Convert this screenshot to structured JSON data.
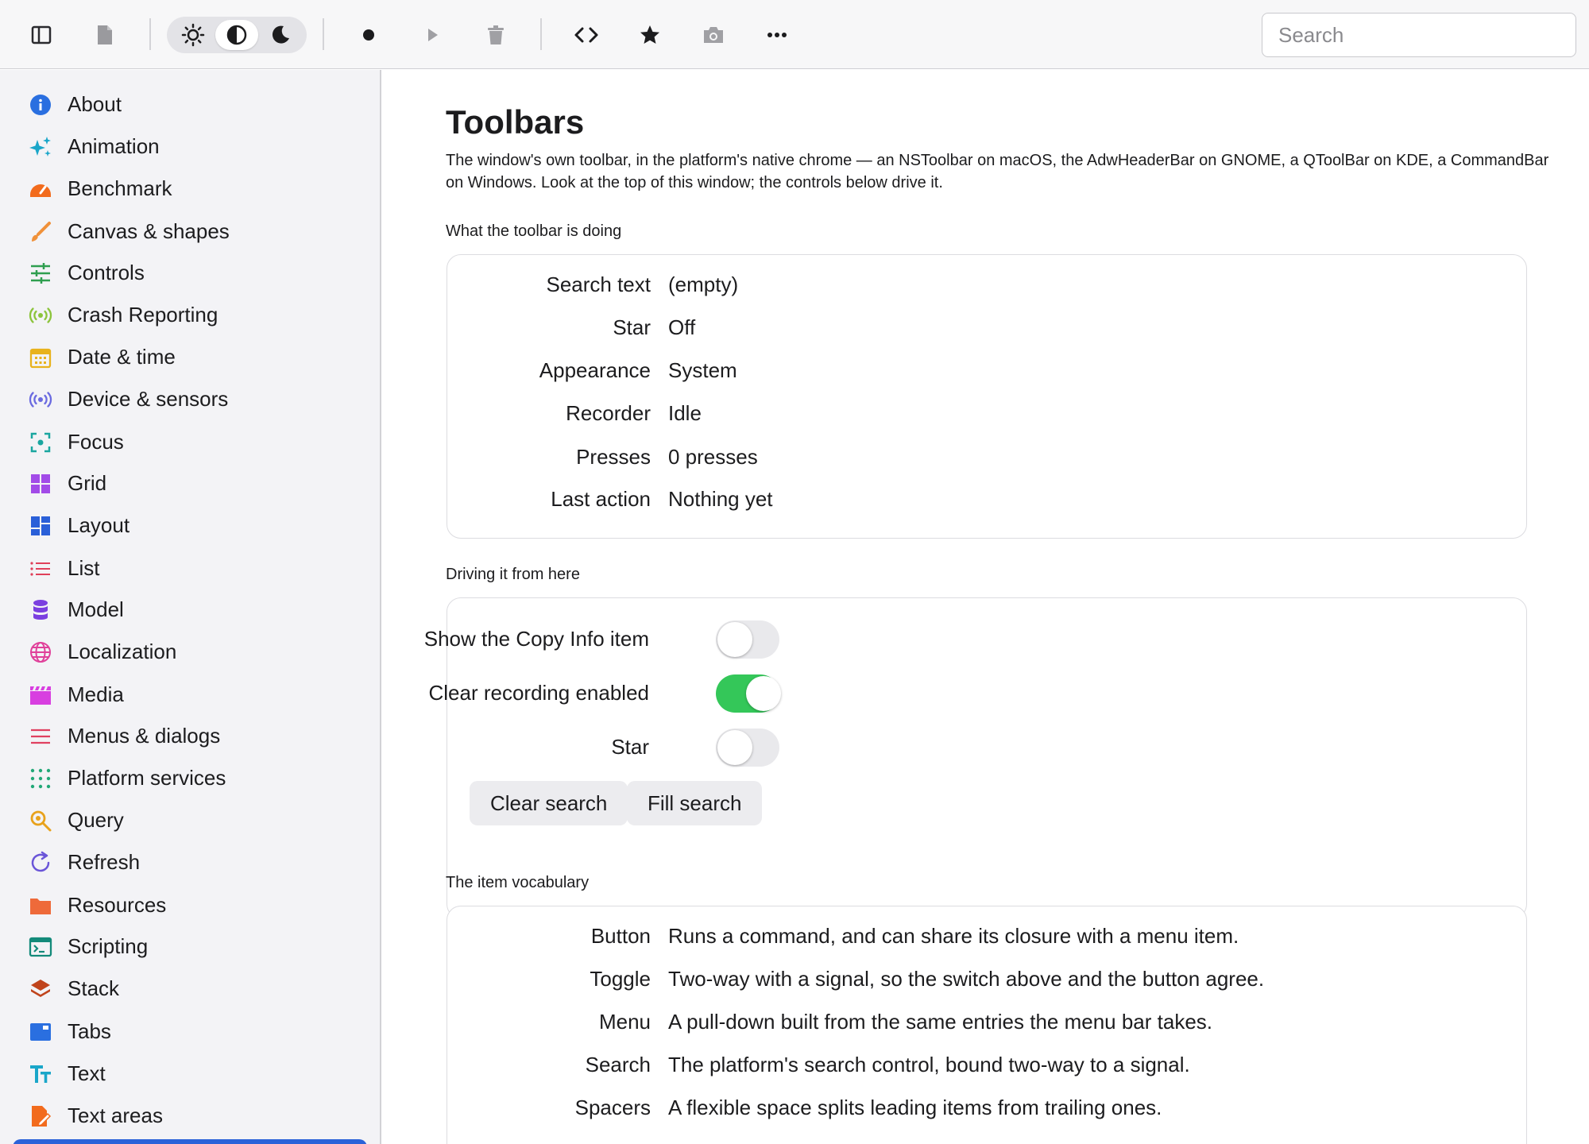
{
  "toolbar": {
    "search_placeholder": "Search",
    "search_value": "",
    "icons": [
      "sidebar-toggle-icon",
      "document-icon",
      "sun-icon",
      "contrast-icon",
      "moon-icon",
      "record-icon",
      "play-icon",
      "trash-icon",
      "code-icon",
      "star-icon",
      "camera-icon",
      "more-icon"
    ],
    "appearance_selected": "System"
  },
  "sidebar": {
    "items": [
      {
        "label": "About",
        "icon": "info-icon",
        "color": "#2a6fe0"
      },
      {
        "label": "Animation",
        "icon": "sparkles-icon",
        "color": "#1aa6c9"
      },
      {
        "label": "Benchmark",
        "icon": "gauge-icon",
        "color": "#f26b1d"
      },
      {
        "label": "Canvas & shapes",
        "icon": "brush-icon",
        "color": "#f0913a"
      },
      {
        "label": "Controls",
        "icon": "sliders-icon",
        "color": "#2e9e4f"
      },
      {
        "label": "Crash Reporting",
        "icon": "broadcast-icon",
        "color": "#8cc43c"
      },
      {
        "label": "Date & time",
        "icon": "calendar-icon",
        "color": "#e8b21c"
      },
      {
        "label": "Device & sensors",
        "icon": "sensor-icon",
        "color": "#6a6ae0"
      },
      {
        "label": "Focus",
        "icon": "focus-icon",
        "color": "#1aa6a0"
      },
      {
        "label": "Grid",
        "icon": "grid-icon",
        "color": "#a24be8"
      },
      {
        "label": "Layout",
        "icon": "layout-icon",
        "color": "#2a5fd8"
      },
      {
        "label": "List",
        "icon": "list-icon",
        "color": "#e0405a"
      },
      {
        "label": "Model",
        "icon": "database-icon",
        "color": "#7b3fe0"
      },
      {
        "label": "Localization",
        "icon": "globe-icon",
        "color": "#e0409a"
      },
      {
        "label": "Media",
        "icon": "clapper-icon",
        "color": "#d83fe0"
      },
      {
        "label": "Menus & dialogs",
        "icon": "menu-icon",
        "color": "#e04060"
      },
      {
        "label": "Platform services",
        "icon": "dots-grid-icon",
        "color": "#22a878"
      },
      {
        "label": "Query",
        "icon": "magnifier-icon",
        "color": "#e8a21c"
      },
      {
        "label": "Refresh",
        "icon": "refresh-icon",
        "color": "#6a55d8"
      },
      {
        "label": "Resources",
        "icon": "folder-icon",
        "color": "#ee6a3a"
      },
      {
        "label": "Scripting",
        "icon": "terminal-icon",
        "color": "#138a7a"
      },
      {
        "label": "Stack",
        "icon": "layers-icon",
        "color": "#c0441c"
      },
      {
        "label": "Tabs",
        "icon": "tabs-icon",
        "color": "#2a6fe0"
      },
      {
        "label": "Text",
        "icon": "text-icon",
        "color": "#1aa6c9"
      },
      {
        "label": "Text areas",
        "icon": "edit-doc-icon",
        "color": "#f26b1d"
      }
    ]
  },
  "main": {
    "title": "Toolbars",
    "description": "The window's own toolbar, in the platform's native chrome — an NSToolbar on macOS, the AdwHeaderBar on GNOME, a QToolBar on KDE, a CommandBar on Windows. Look at the top of this window; the controls below drive it.",
    "status_section": {
      "label": "What the toolbar is doing",
      "rows": [
        {
          "key": "Search text",
          "value": "(empty)"
        },
        {
          "key": "Star",
          "value": "Off"
        },
        {
          "key": "Appearance",
          "value": "System"
        },
        {
          "key": "Recorder",
          "value": "Idle"
        },
        {
          "key": "Presses",
          "value": "0 presses"
        },
        {
          "key": "Last action",
          "value": "Nothing yet"
        }
      ]
    },
    "controls_section": {
      "label": "Driving it from here",
      "toggles": [
        {
          "label": "Show the Copy Info item",
          "on": false
        },
        {
          "label": "Clear recording enabled",
          "on": true
        },
        {
          "label": "Star",
          "on": false
        }
      ],
      "buttons": [
        "Clear search",
        "Fill search"
      ]
    },
    "vocab_section": {
      "label": "The item vocabulary",
      "rows": [
        {
          "key": "Button",
          "value": "Runs a command, and can share its closure with a menu item."
        },
        {
          "key": "Toggle",
          "value": "Two-way with a signal, so the switch above and the button agree."
        },
        {
          "key": "Menu",
          "value": "A pull-down built from the same entries the menu bar takes."
        },
        {
          "key": "Search",
          "value": "The platform's search control, bound two-way to a signal."
        },
        {
          "key": "Spacers",
          "value": "A flexible space splits leading items from trailing ones."
        }
      ]
    }
  }
}
